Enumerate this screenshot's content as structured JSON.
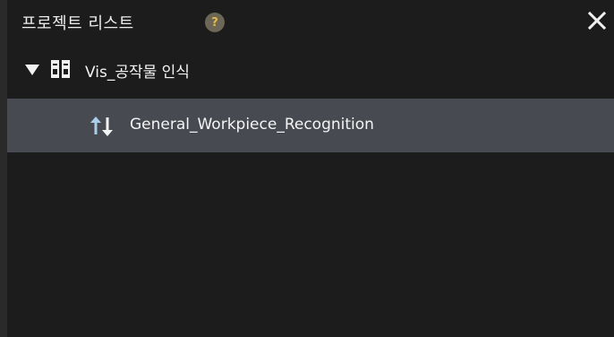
{
  "panel": {
    "title": "프로젝트 리스트",
    "help_symbol": "?",
    "close_icon": "close-icon"
  },
  "tree": {
    "solution": {
      "label": "Vis_공작물 인식",
      "expanded": true,
      "icon": "solution-icon"
    },
    "projects": [
      {
        "label": "General_Workpiece_Recognition",
        "icon": "sort-arrows-icon",
        "selected": true
      }
    ]
  },
  "colors": {
    "background": "#1c1c1c",
    "selected_row": "#474a51",
    "help_badge": "#6b6656",
    "help_symbol": "#e6b84a",
    "arrow_accent": "#a9cdea"
  }
}
